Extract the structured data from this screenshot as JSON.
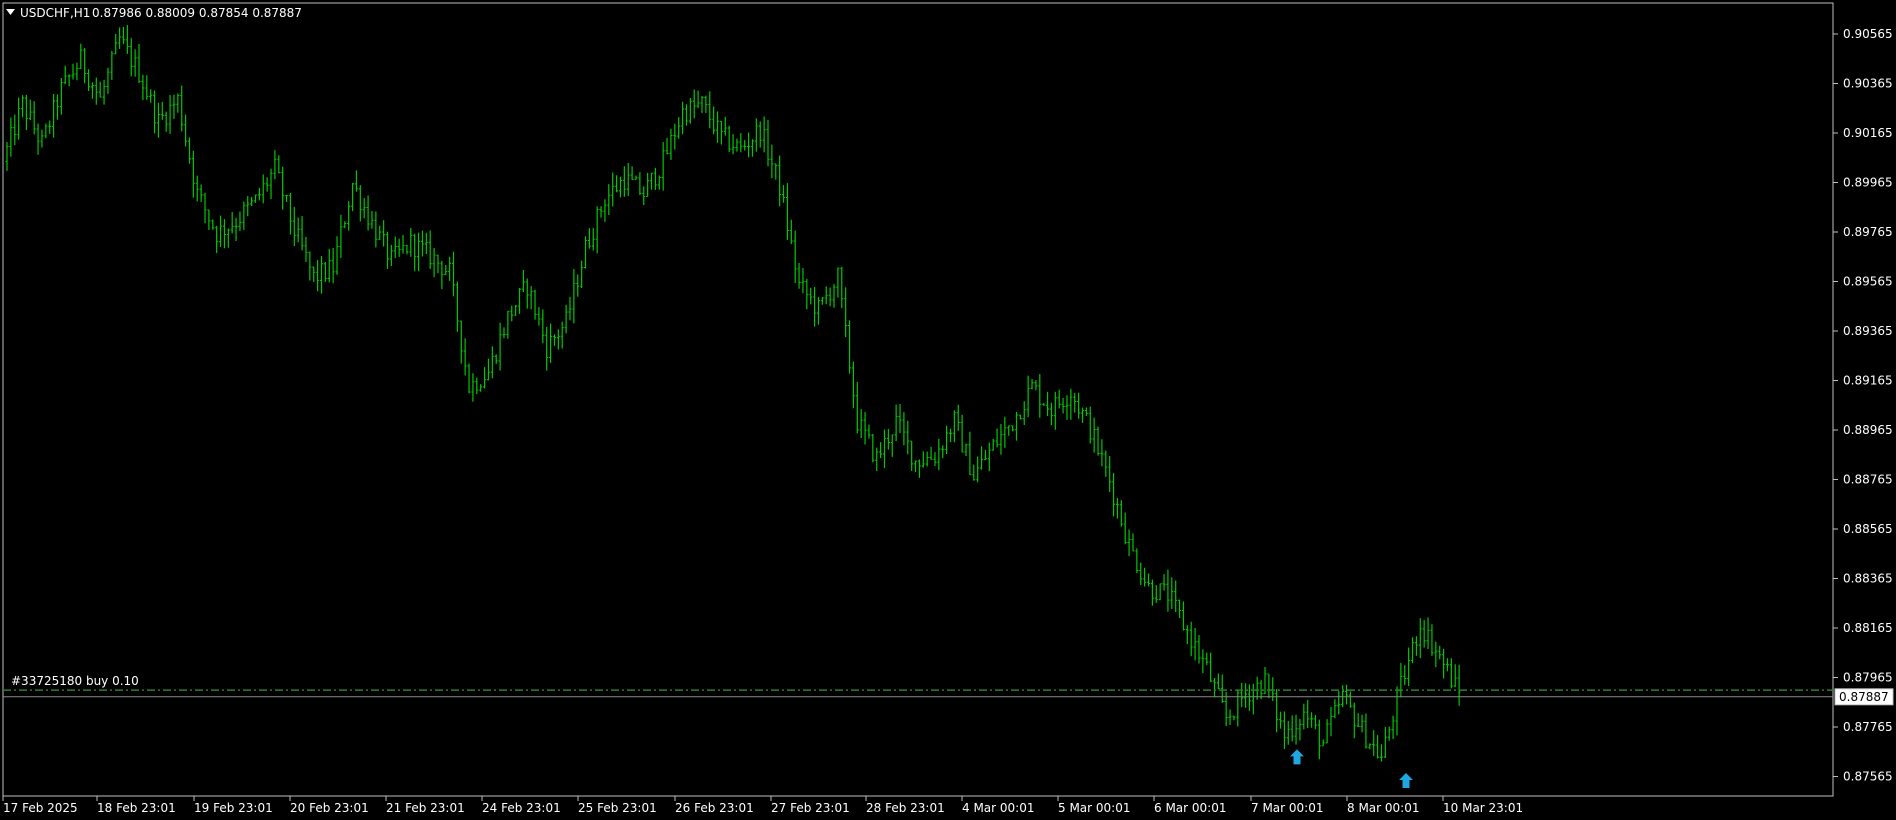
{
  "header": {
    "symbol": "USDCHF,H1",
    "ohlc": "0.87986 0.88009 0.87854 0.87887"
  },
  "order": {
    "label": "#33725180 buy 0.10",
    "price": 0.87914
  },
  "current_price": {
    "label": "0.87887",
    "value": 0.87887
  },
  "colors": {
    "background": "#000000",
    "bars": "#00c800",
    "axis": "#c0c0c0",
    "text": "#ffffff",
    "order_line": "#2e7d32",
    "arrow": "#1ea7e0",
    "price_box_bg": "#ffffff",
    "price_box_text": "#000000"
  },
  "chart_data": {
    "type": "ohlc",
    "y_ticks": [
      "0.90565",
      "0.90365",
      "0.90165",
      "0.89965",
      "0.89765",
      "0.89565",
      "0.89365",
      "0.89165",
      "0.88965",
      "0.88765",
      "0.88565",
      "0.88365",
      "0.88165",
      "0.87965",
      "0.87765",
      "0.87565"
    ],
    "ylim": [
      0.8746,
      0.9067
    ],
    "x_ticks": [
      "17 Feb 2025",
      "18 Feb 23:01",
      "19 Feb 23:01",
      "20 Feb 23:01",
      "21 Feb 23:01",
      "24 Feb 23:01",
      "25 Feb 23:01",
      "26 Feb 23:01",
      "27 Feb 23:01",
      "28 Feb 23:01",
      "4 Mar 00:01",
      "5 Mar 00:01",
      "6 Mar 00:01",
      "7 Mar 00:01",
      "8 Mar 00:01",
      "10 Mar 23:01"
    ],
    "closes": [
      0.9005,
      0.9028,
      0.9012,
      0.9034,
      0.9046,
      0.903,
      0.9054,
      0.9041,
      0.9021,
      0.903,
      0.8992,
      0.8976,
      0.8981,
      0.8989,
      0.9002,
      0.8977,
      0.8958,
      0.8962,
      0.8996,
      0.898,
      0.8965,
      0.8972,
      0.8967,
      0.896,
      0.8914,
      0.892,
      0.8942,
      0.8955,
      0.893,
      0.894,
      0.897,
      0.899,
      0.8998,
      0.8992,
      0.9005,
      0.9025,
      0.9028,
      0.9015,
      0.901,
      0.9018,
      0.8995,
      0.8955,
      0.8945,
      0.8958,
      0.89,
      0.8885,
      0.89,
      0.8884,
      0.8886,
      0.89,
      0.8878,
      0.889,
      0.89,
      0.8914,
      0.8905,
      0.8912,
      0.8897,
      0.8876,
      0.885,
      0.8833,
      0.883,
      0.8815,
      0.88,
      0.878,
      0.879,
      0.8795,
      0.8773,
      0.8782,
      0.877,
      0.8789,
      0.8775,
      0.8764,
      0.8793,
      0.8818,
      0.8805,
      0.879
    ],
    "signal_arrows": [
      {
        "x_index": 64,
        "price": 0.87735
      },
      {
        "x_index": 71,
        "price": 0.8764
      }
    ]
  }
}
